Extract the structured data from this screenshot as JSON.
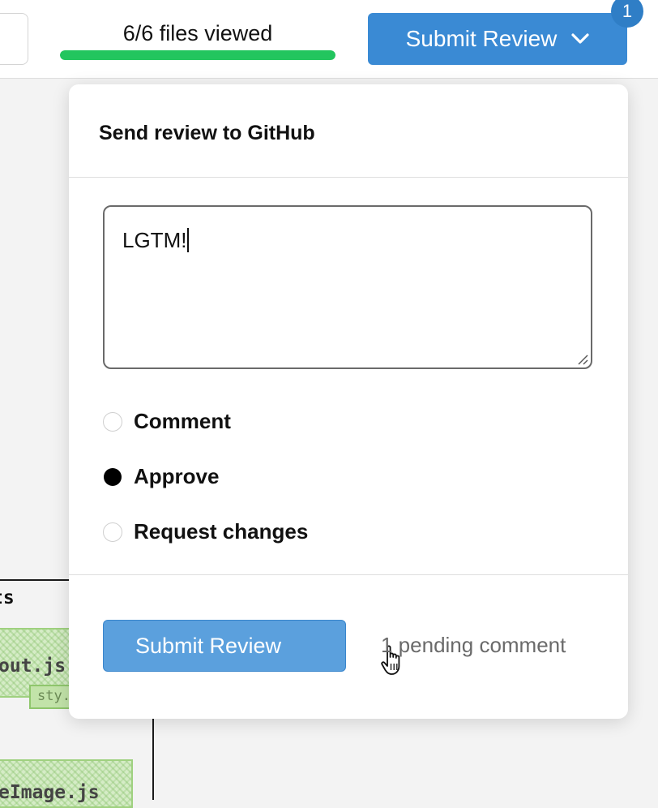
{
  "header": {
    "files_viewed_label": "6/6 files viewed",
    "files_viewed_fraction": 1.0,
    "submit_button_label": "Submit Review",
    "notification_count": "1"
  },
  "background_diagram": {
    "title_fragment": "ts",
    "node_a_fragment": "out.js",
    "chip_fragment": "sty.",
    "node_b_fragment": "eImage.js"
  },
  "review_popover": {
    "title": "Send review to GitHub",
    "comment_text": "LGTM!",
    "options": [
      {
        "label": "Comment",
        "checked": false
      },
      {
        "label": "Approve",
        "checked": true
      },
      {
        "label": "Request changes",
        "checked": false
      }
    ],
    "submit_label": "Submit Review",
    "pending_text": "1 pending comment"
  },
  "colors": {
    "accent": "#3a8ad4",
    "progress": "#22c55e",
    "diagram_node": "#d5ecc6"
  },
  "icons": {
    "dropdown": "chevron-down-icon",
    "cursor": "pointer-hand-icon",
    "resize": "resize-handle-icon"
  }
}
